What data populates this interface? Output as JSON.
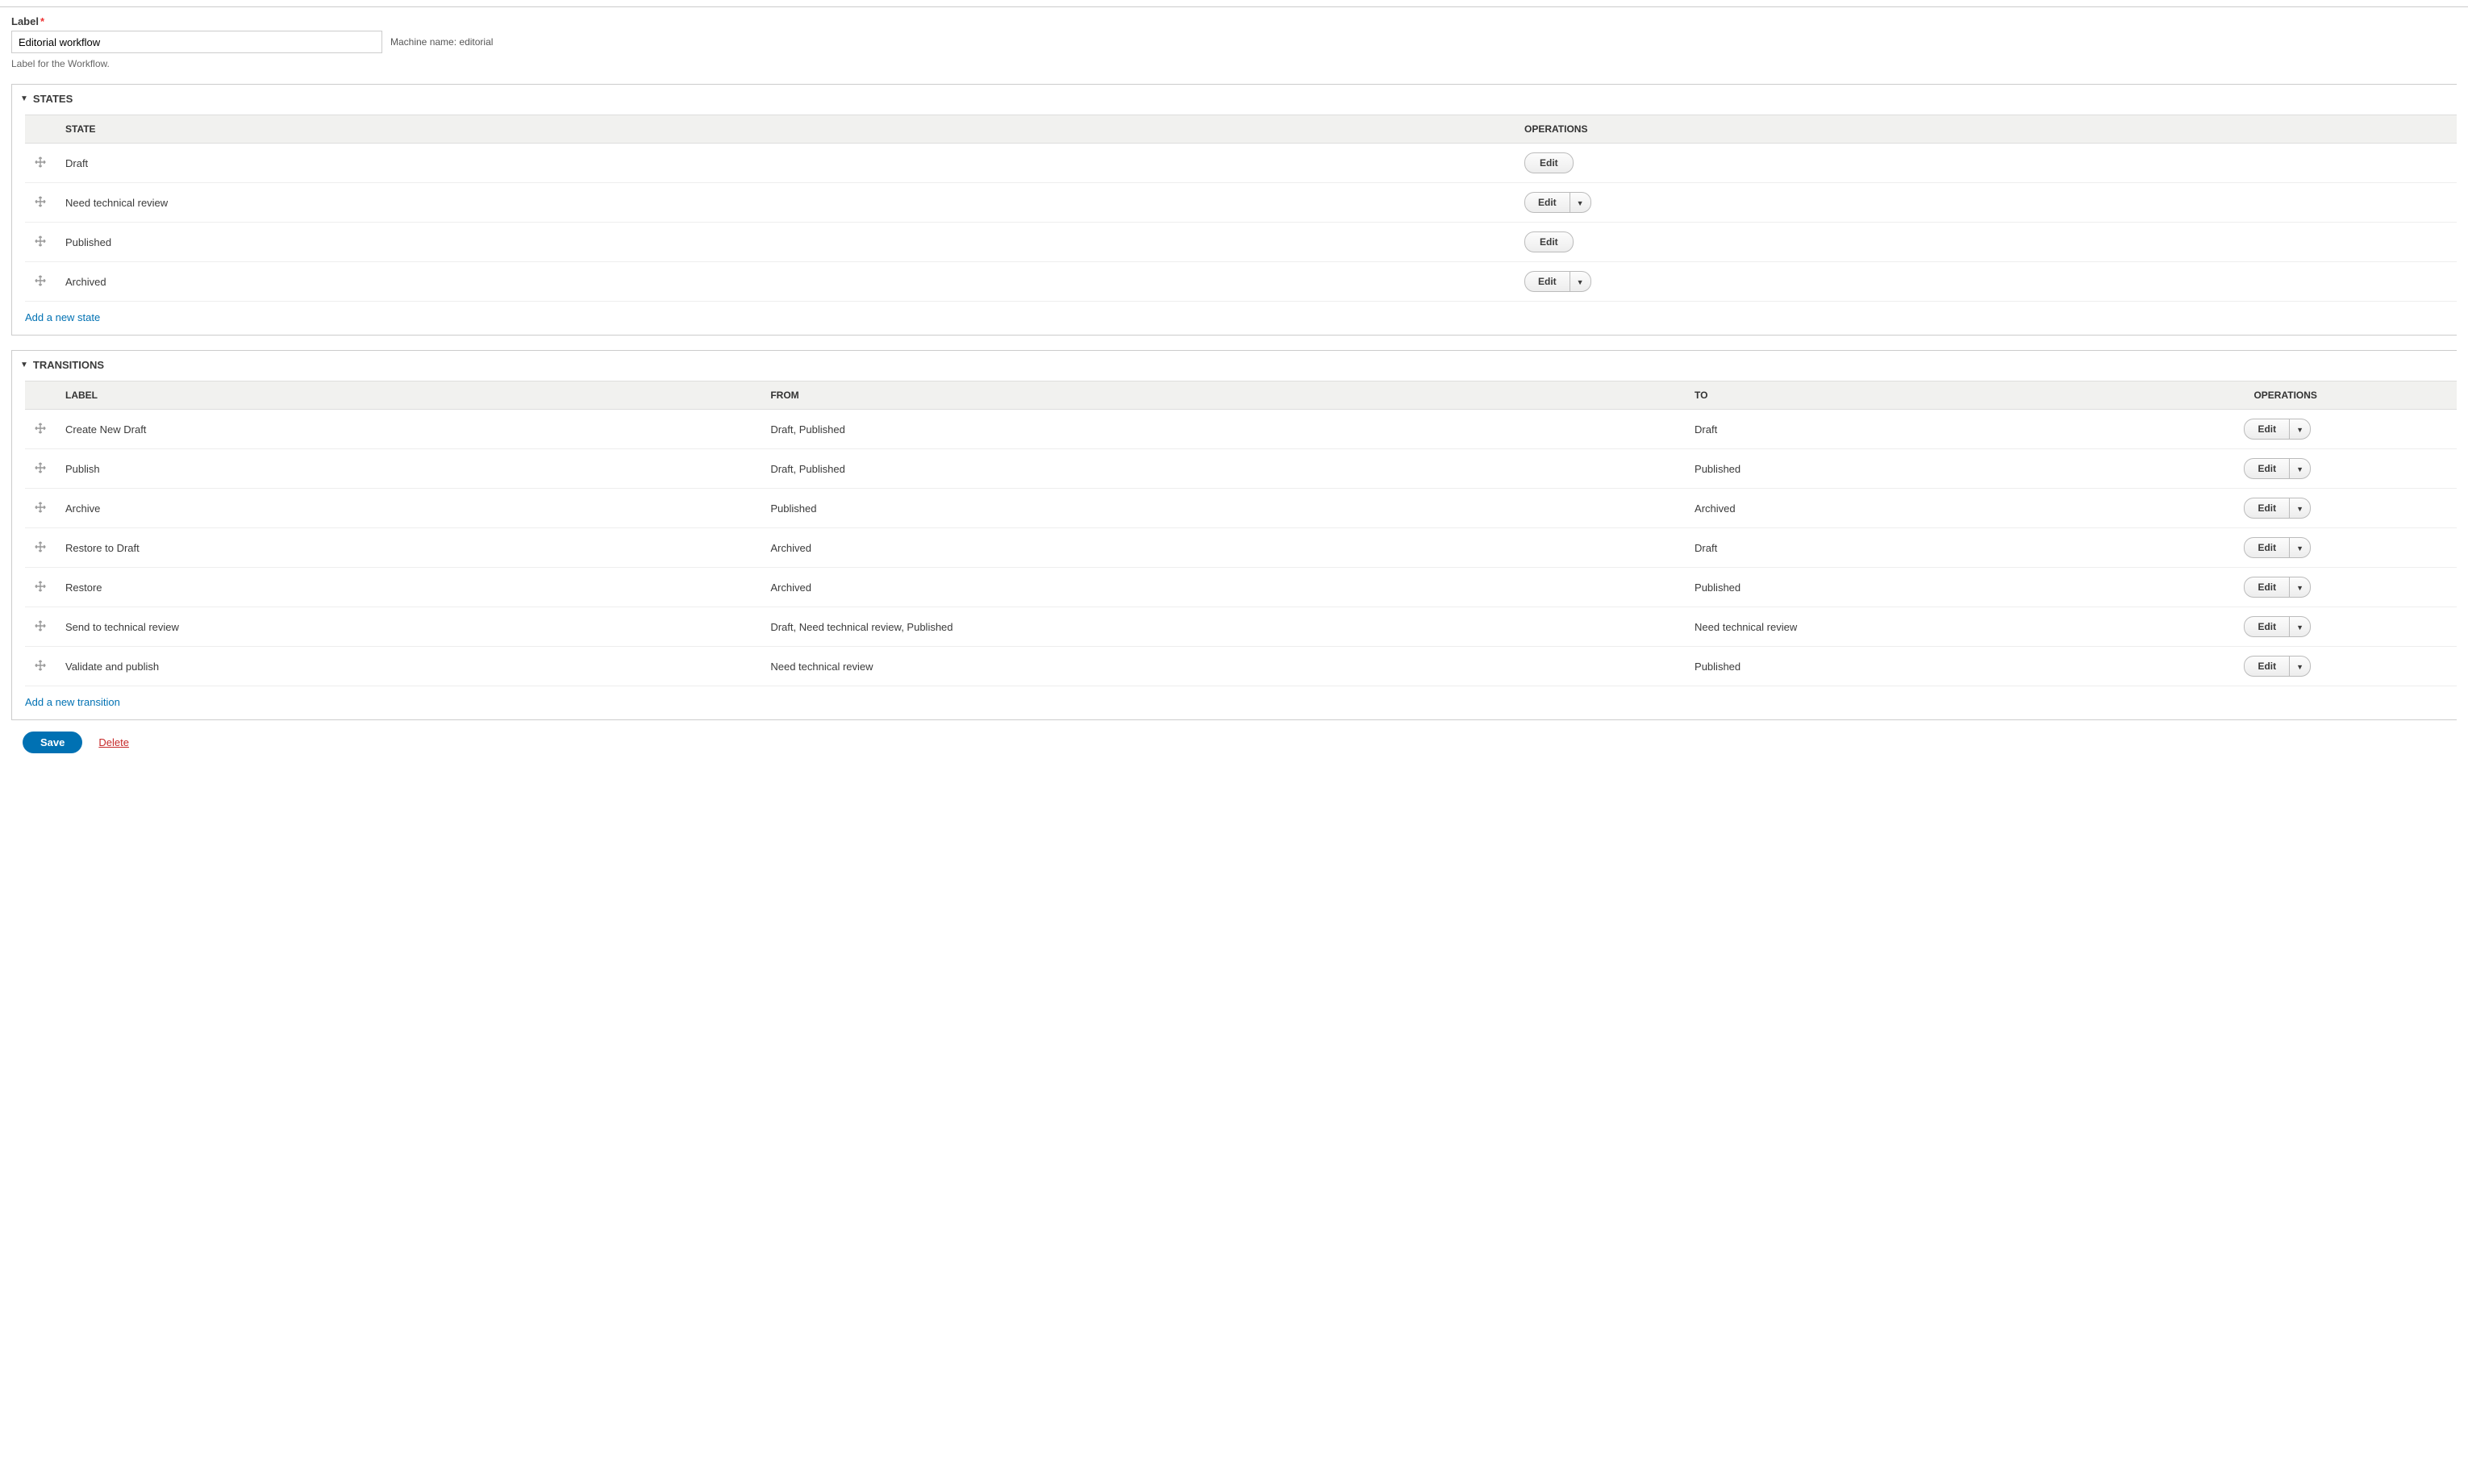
{
  "labelField": {
    "label": "Label",
    "value": "Editorial workflow",
    "machineNamePrefix": "Machine name:",
    "machineName": "editorial",
    "description": "Label for the Workflow."
  },
  "sections": {
    "states": {
      "title": "STATES",
      "headers": {
        "state": "STATE",
        "operations": "OPERATIONS"
      },
      "rows": [
        {
          "name": "Draft",
          "hasDropdown": false
        },
        {
          "name": "Need technical review",
          "hasDropdown": true
        },
        {
          "name": "Published",
          "hasDropdown": false
        },
        {
          "name": "Archived",
          "hasDropdown": true
        }
      ],
      "addLabel": "Add a new state"
    },
    "transitions": {
      "title": "TRANSITIONS",
      "headers": {
        "label": "LABEL",
        "from": "FROM",
        "to": "TO",
        "operations": "OPERATIONS"
      },
      "rows": [
        {
          "label": "Create New Draft",
          "from": "Draft, Published",
          "to": "Draft",
          "hasDropdown": true
        },
        {
          "label": "Publish",
          "from": "Draft, Published",
          "to": "Published",
          "hasDropdown": true
        },
        {
          "label": "Archive",
          "from": "Published",
          "to": "Archived",
          "hasDropdown": true
        },
        {
          "label": "Restore to Draft",
          "from": "Archived",
          "to": "Draft",
          "hasDropdown": true
        },
        {
          "label": "Restore",
          "from": "Archived",
          "to": "Published",
          "hasDropdown": true
        },
        {
          "label": "Send to technical review",
          "from": "Draft, Need technical review, Published",
          "to": "Need technical review",
          "hasDropdown": true
        },
        {
          "label": "Validate and publish",
          "from": "Need technical review",
          "to": "Published",
          "hasDropdown": true
        }
      ],
      "addLabel": "Add a new transition"
    }
  },
  "buttons": {
    "edit": "Edit",
    "save": "Save",
    "delete": "Delete"
  }
}
